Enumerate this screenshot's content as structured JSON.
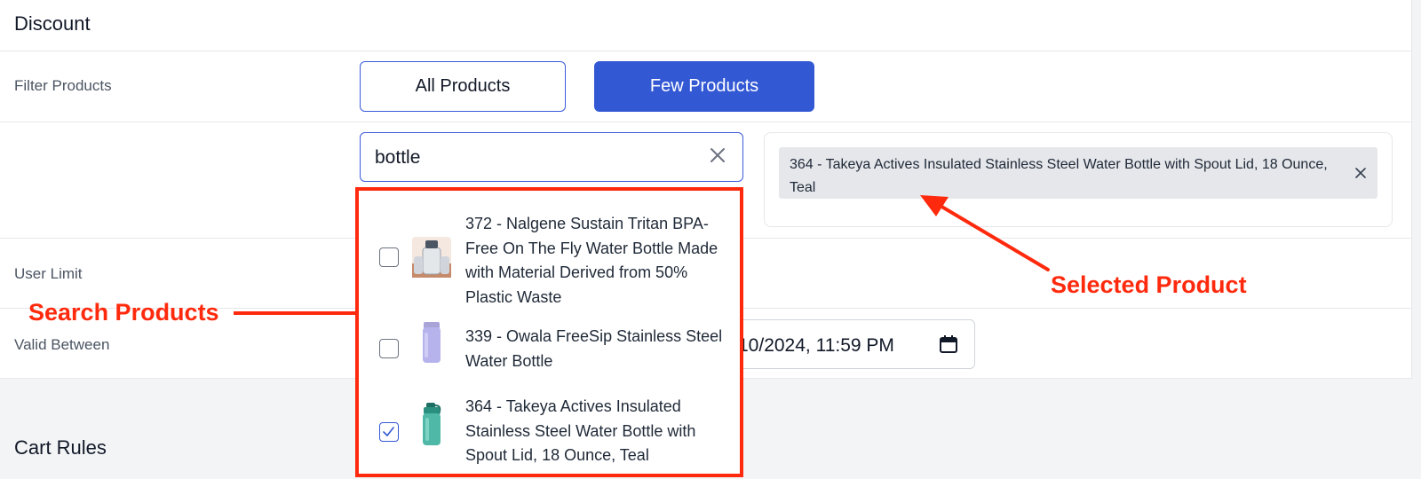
{
  "discount_section": {
    "title": "Discount"
  },
  "filter_products": {
    "label": "Filter Products",
    "all_products_label": "All Products",
    "few_products_label": "Few Products"
  },
  "search": {
    "value": "bottle",
    "clear_icon": "close-icon"
  },
  "selected_products": [
    {
      "label": "364 - Takeya Actives Insulated Stainless Steel Water Bottle with Spout Lid, 18 Ounce, Teal"
    }
  ],
  "user_limit": {
    "label": "User Limit"
  },
  "valid_between": {
    "label": "Valid Between",
    "end_value": "10/2024, 11:59 PM"
  },
  "search_results": [
    {
      "label": "372 - Nalgene Sustain Tritan BPA-Free On The Fly Water Bottle Made with Material Derived from 50% Plastic Waste",
      "checked": false
    },
    {
      "label": "339 - Owala FreeSip Stainless Steel Water Bottle",
      "checked": false
    },
    {
      "label": "364 - Takeya Actives Insulated Stainless Steel Water Bottle with Spout Lid, 18 Ounce, Teal",
      "checked": true
    }
  ],
  "cart_rules": {
    "title": "Cart Rules"
  },
  "annotations": {
    "search_products": "Search Products",
    "selected_product": "Selected Product"
  },
  "colors": {
    "primary": "#3358d4",
    "annotation": "#ff2a0d",
    "chip_bg": "#e5e7eb"
  }
}
